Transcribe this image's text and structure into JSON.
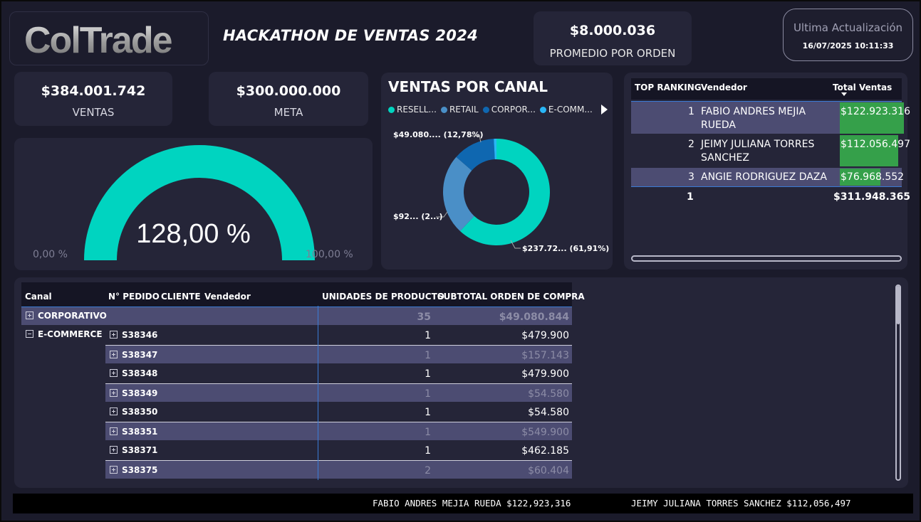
{
  "header": {
    "logo_text": "ColTrade",
    "title": "HACKATHON DE VENTAS 2024",
    "avg_order": {
      "value": "$8.000.036",
      "label": "PROMEDIO POR ORDEN"
    },
    "update": {
      "label": "Ultima Actualización",
      "value": "16/07/2025 10:11:33"
    }
  },
  "kpis": {
    "ventas": {
      "value": "$384.001.742",
      "label": "VENTAS"
    },
    "meta": {
      "value": "$300.000.000",
      "label": "META"
    }
  },
  "gauge": {
    "percent_text": "128,00 %",
    "min_label": "0,00 %",
    "max_label": "100,00 %",
    "fill_fraction": 1.0,
    "color": "#00d4c0",
    "track_color": "#3a3a4e"
  },
  "channels": {
    "title": "VENTAS POR CANAL",
    "legend": [
      {
        "label": "RESELL...",
        "color": "#00d4c0"
      },
      {
        "label": "RETAIL",
        "color": "#4a8fc7"
      },
      {
        "label": "CORPOR...",
        "color": "#0f67b0"
      },
      {
        "label": "E-COMM...",
        "color": "#29b6f6"
      }
    ],
    "data_labels": {
      "corporativo": "$49.080.... (12,78%)",
      "retail": "$92... (2...)",
      "reseller": "$237.72... (61,91%)"
    }
  },
  "chart_data": {
    "type": "pie",
    "title": "VENTAS POR CANAL",
    "categories": [
      "RESELLER",
      "RETAIL",
      "CORPORATIVO",
      "E-COMMERCE"
    ],
    "values": [
      61.91,
      24.5,
      12.78,
      0.81
    ],
    "colors": [
      "#00d4c0",
      "#4a8fc7",
      "#0f67b0",
      "#29b6f6"
    ],
    "legend": "top"
  },
  "ranking": {
    "headers": {
      "rank": "TOP RANKING",
      "seller": "Vendedor",
      "total": "Total Ventas"
    },
    "rows": [
      {
        "rank": "1",
        "name": "FABIO ANDRES MEJIA RUEDA",
        "total": "$122.923.316",
        "bar_fraction": 1.0
      },
      {
        "rank": "2",
        "name": "JEIMY JULIANA TORRES SANCHEZ",
        "total": "$112.056.497",
        "bar_fraction": 0.91
      },
      {
        "rank": "3",
        "name": "ANGIE RODRIGUEZ DAZA",
        "total": "$76.968.552",
        "bar_fraction": 0.63
      }
    ],
    "total_rank": "1",
    "total_value": "$311.948.365",
    "bar_color": "#35a04a"
  },
  "matrix": {
    "headers": {
      "canal": "Canal",
      "pedido": "N° PEDIDO",
      "cliente": "CLIENTE",
      "vendedor": "Vendedor",
      "unidades": "UNIDADES DE PRODUCTO",
      "subtotal": "SUBTOTAL ORDEN DE COMPRA"
    },
    "groups": [
      {
        "channel": "CORPORATIVO",
        "units": "35",
        "subtotal": "$49.080.844",
        "expanded": false
      },
      {
        "channel": "E-COMMERCE",
        "expanded": true
      }
    ],
    "orders": [
      {
        "id": "S38346",
        "units": "1",
        "subtotal": "$479.900"
      },
      {
        "id": "S38347",
        "units": "1",
        "subtotal": "$157.143"
      },
      {
        "id": "S38348",
        "units": "1",
        "subtotal": "$479.900"
      },
      {
        "id": "S38349",
        "units": "1",
        "subtotal": "$54.580"
      },
      {
        "id": "S38350",
        "units": "1",
        "subtotal": "$54.580"
      },
      {
        "id": "S38351",
        "units": "1",
        "subtotal": "$549.900"
      },
      {
        "id": "S38371",
        "units": "1",
        "subtotal": "$462.185"
      },
      {
        "id": "S38375",
        "units": "2",
        "subtotal": "$60.404"
      }
    ]
  },
  "ticker": [
    "FABIO ANDRES MEJIA RUEDA $122,923,316",
    "JEIMY JULIANA TORRES SANCHEZ $112,056,497"
  ]
}
